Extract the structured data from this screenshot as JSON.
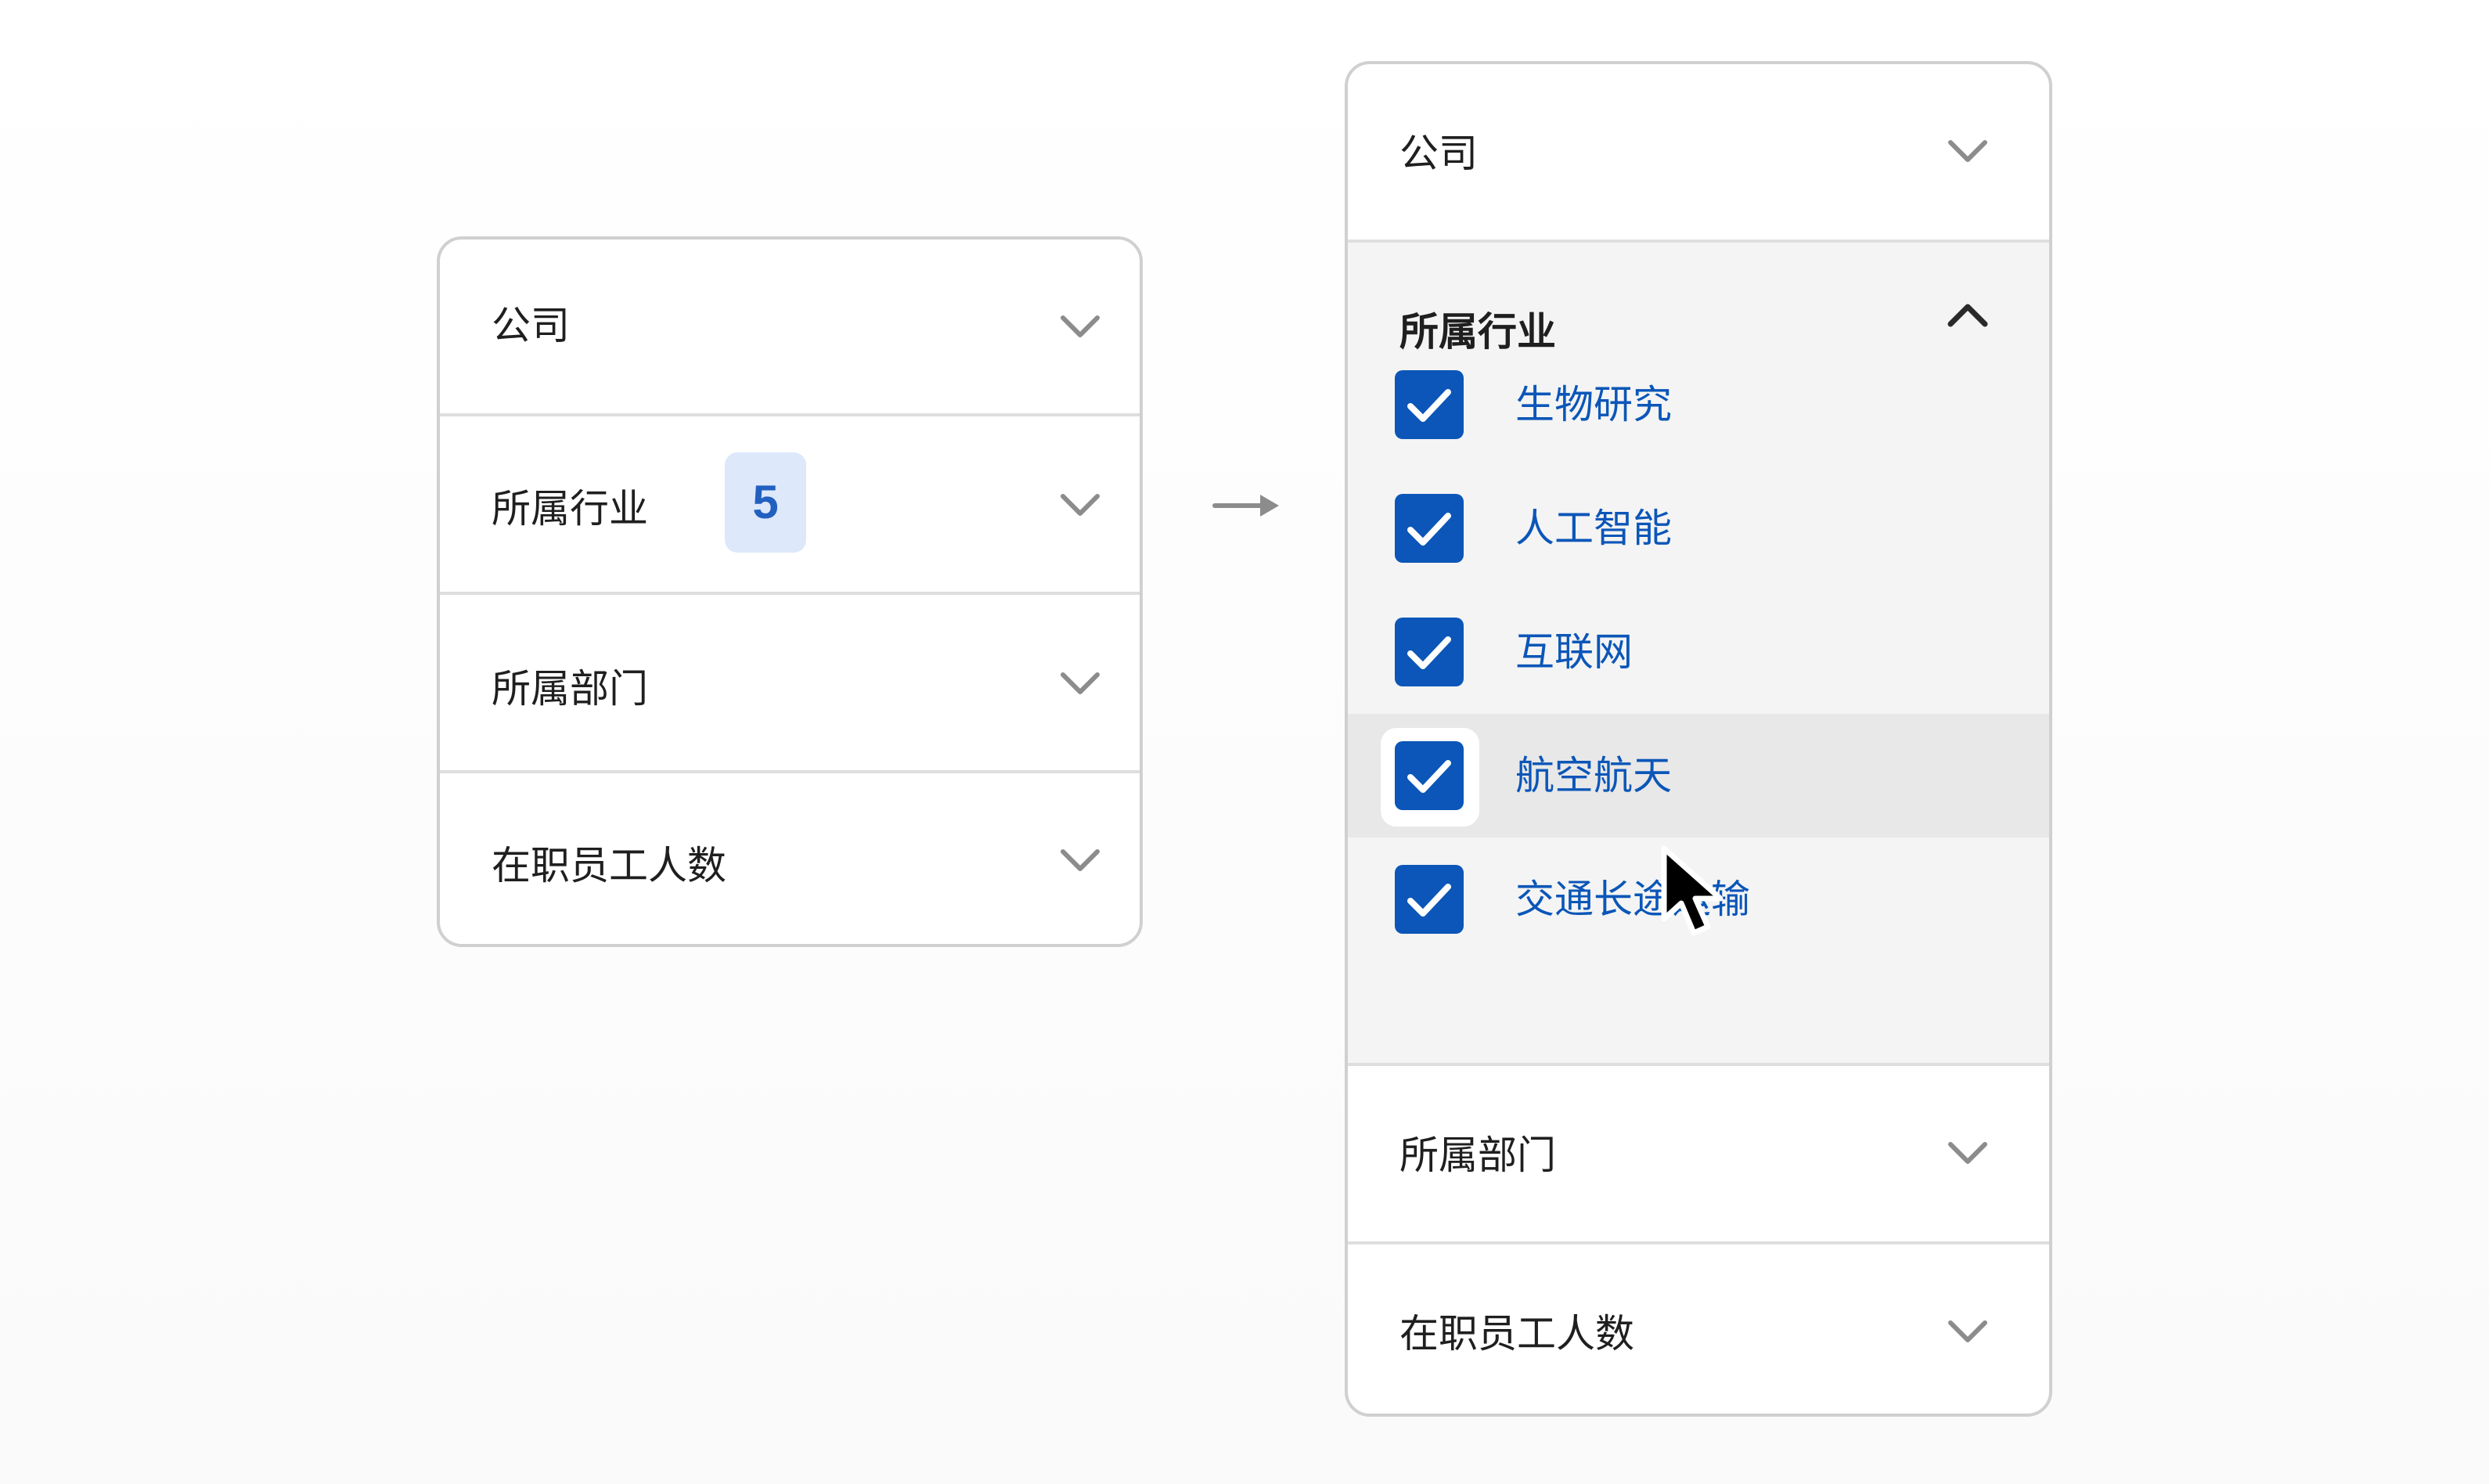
{
  "colors": {
    "accent": "#0b56b8",
    "badge_bg": "#dde8fa",
    "badge_text": "#2260c0",
    "expanded_bg": "#f4f4f4",
    "hover_bg": "#e8e8e8",
    "border": "#d0d0d0"
  },
  "left_panel": {
    "rows": [
      {
        "label": "公司",
        "icon": "chevron-down-icon"
      },
      {
        "label": "所属行业",
        "badge": "5",
        "icon": "chevron-down-icon"
      },
      {
        "label": "所属部门",
        "icon": "chevron-down-icon"
      },
      {
        "label": "在职员工人数",
        "icon": "chevron-down-icon"
      }
    ]
  },
  "transition_icon": "arrow-right-icon",
  "right_panel": {
    "company": {
      "label": "公司",
      "icon": "chevron-down-icon"
    },
    "industry": {
      "label": "所属行业",
      "icon": "chevron-up-icon",
      "options": [
        {
          "label": "生物研究",
          "checked": true
        },
        {
          "label": "人工智能",
          "checked": true
        },
        {
          "label": "互联网",
          "checked": true
        },
        {
          "label": "航空航天",
          "checked": true,
          "hovered": true
        },
        {
          "label": "交通长途运输",
          "checked": true
        }
      ]
    },
    "department": {
      "label": "所属部门",
      "icon": "chevron-down-icon"
    },
    "headcount": {
      "label": "在职员工人数",
      "icon": "chevron-down-icon"
    }
  },
  "cursor_icon": "mouse-pointer-icon"
}
